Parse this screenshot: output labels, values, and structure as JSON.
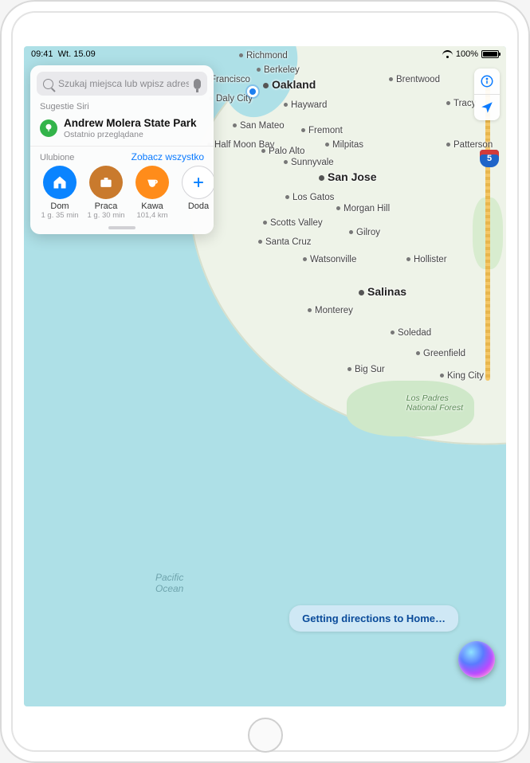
{
  "status": {
    "time": "09:41",
    "date": "Wt. 15.09",
    "battery_pct": "100%"
  },
  "search": {
    "placeholder": "Szukaj miejsca lub wpisz adres"
  },
  "siri_section_label": "Sugestie Siri",
  "suggestion": {
    "icon": "tree-icon",
    "title": "Andrew Molera State Park",
    "subtitle": "Ostatnio przeglądane"
  },
  "favorites": {
    "label": "Ulubione",
    "see_all": "Zobacz wszystko",
    "items": [
      {
        "name": "Dom",
        "sub": "1 g. 35 min",
        "icon": "home-icon",
        "color": "c-home"
      },
      {
        "name": "Praca",
        "sub": "1 g. 30 min",
        "icon": "briefcase-icon",
        "color": "c-work"
      },
      {
        "name": "Kawa",
        "sub": "101,4 km",
        "icon": "coffee-icon",
        "color": "c-coffee"
      },
      {
        "name": "Doda",
        "sub": "",
        "icon": "plus-icon",
        "color": "c-add"
      }
    ]
  },
  "siri_bubble": "Getting directions to Home…",
  "ocean_label_1": "Pacific",
  "ocean_label_2": "Ocean",
  "forest_label_1": "Los Padres",
  "forest_label_2": "National Forest",
  "shield_i5": "5",
  "cities": {
    "richmond": "Richmond",
    "berkeley": "Berkeley",
    "francisco": "Francisco",
    "oakland": "Oakland",
    "dalycity": "Daly City",
    "hayward": "Hayward",
    "brentwood": "Brentwood",
    "tracy": "Tracy",
    "sanmateo": "San Mateo",
    "fremont": "Fremont",
    "halfmoon": "Half Moon Bay",
    "paloalto": "Palo Alto",
    "milpitas": "Milpitas",
    "sunnyvale": "Sunnyvale",
    "patterson": "Patterson",
    "sanjose": "San Jose",
    "losgatos": "Los Gatos",
    "morganhill": "Morgan Hill",
    "scottsvalley": "Scotts Valley",
    "gilroy": "Gilroy",
    "santacruz": "Santa Cruz",
    "watsonville": "Watsonville",
    "hollister": "Hollister",
    "salinas": "Salinas",
    "monterey": "Monterey",
    "soledad": "Soledad",
    "greenfield": "Greenfield",
    "bigsur": "Big Sur",
    "kingcity": "King City"
  }
}
